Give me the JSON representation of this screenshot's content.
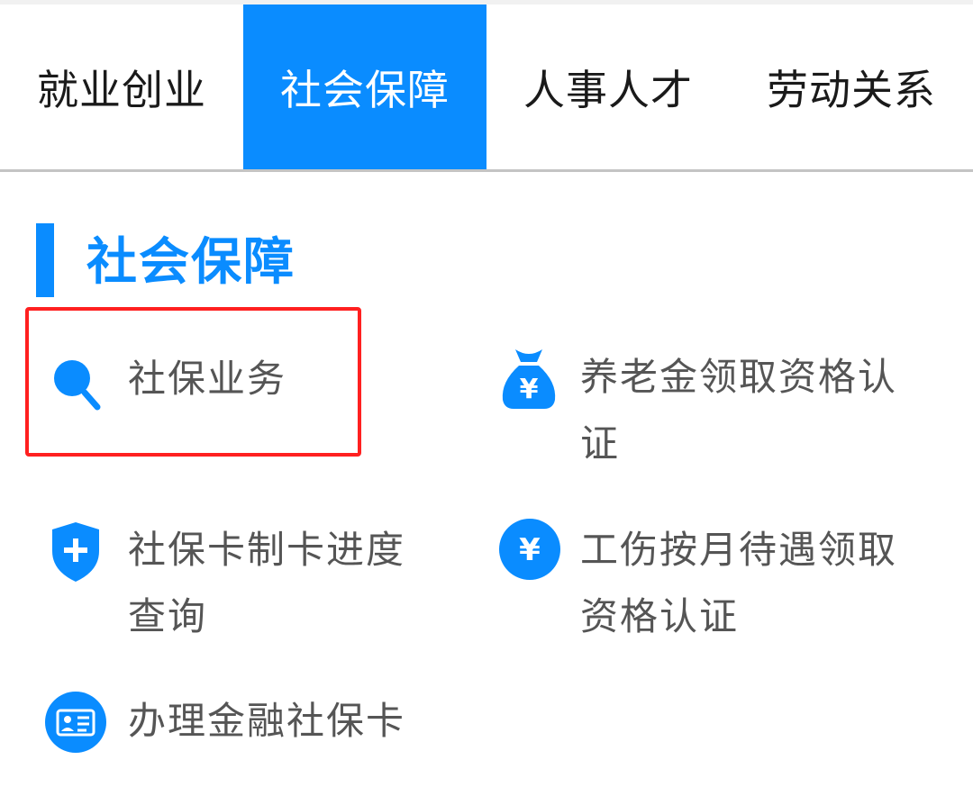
{
  "tabs": [
    {
      "label": "就业创业"
    },
    {
      "label": "社会保障"
    },
    {
      "label": "人事人才"
    },
    {
      "label": "劳动关系"
    }
  ],
  "active_tab_index": 1,
  "section": {
    "title": "社会保障"
  },
  "services": [
    {
      "label": "社保业务",
      "icon": "search-icon"
    },
    {
      "label": "养老金领取资格认证",
      "icon": "money-bag-icon"
    },
    {
      "label": "社保卡制卡进度查询",
      "icon": "shield-plus-icon"
    },
    {
      "label": "工伤按月待遇领取资格认证",
      "icon": "yen-circle-icon"
    },
    {
      "label": "办理金融社保卡",
      "icon": "id-card-icon"
    }
  ],
  "colors": {
    "accent": "#0a8cff",
    "highlight": "#ff2020",
    "label_text": "#555555"
  }
}
